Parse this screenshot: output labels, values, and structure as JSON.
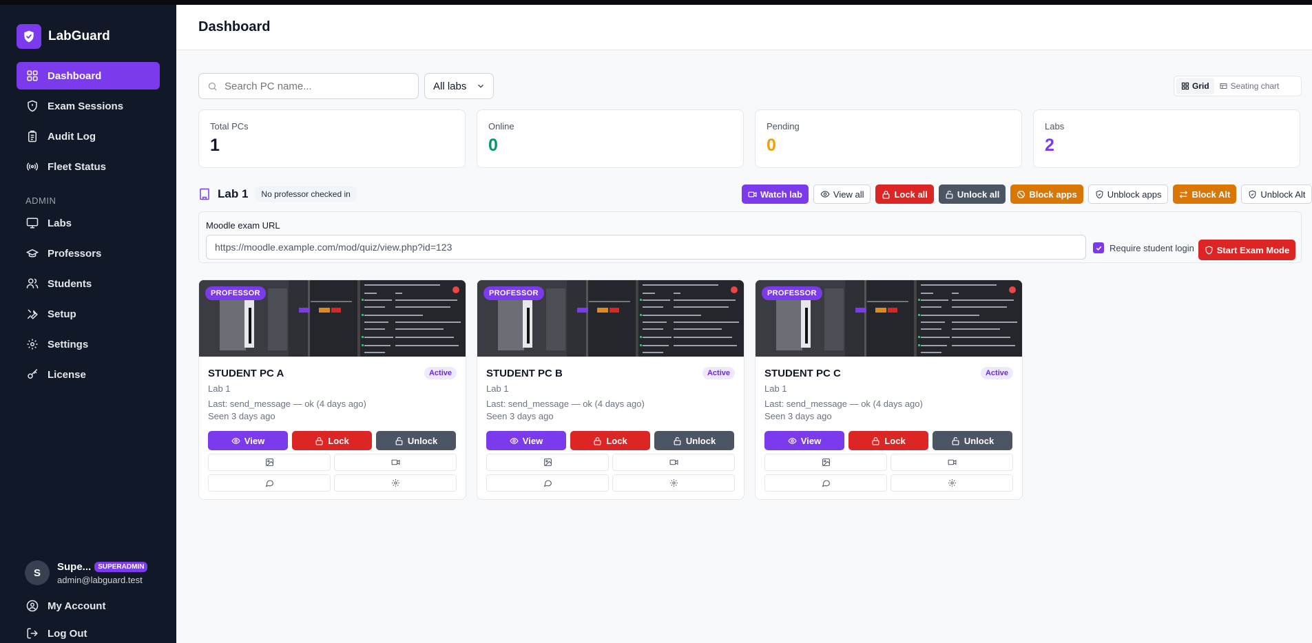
{
  "app": {
    "name": "LabGuard",
    "page_title": "Dashboard"
  },
  "sidebar": {
    "items": [
      {
        "label": "Dashboard",
        "icon": "grid-icon",
        "active": true
      },
      {
        "label": "Exam Sessions",
        "icon": "shield-icon"
      },
      {
        "label": "Audit Log",
        "icon": "clipboard-icon"
      },
      {
        "label": "Fleet Status",
        "icon": "broadcast-icon"
      }
    ],
    "section_label": "ADMIN",
    "admin_items": [
      {
        "label": "Labs",
        "icon": "monitor-icon"
      },
      {
        "label": "Professors",
        "icon": "graduation-cap-icon"
      },
      {
        "label": "Students",
        "icon": "users-icon"
      },
      {
        "label": "Setup",
        "icon": "tools-icon"
      },
      {
        "label": "Settings",
        "icon": "gear-icon"
      },
      {
        "label": "License",
        "icon": "key-icon"
      }
    ],
    "user": {
      "initial": "S",
      "name": "Supe...",
      "role": "SUPERADMIN",
      "email": "admin@labguard.test"
    },
    "footer": {
      "my_account": "My Account",
      "log_out": "Log Out"
    }
  },
  "toolbar": {
    "search_placeholder": "Search PC name...",
    "lab_filter": "All labs",
    "view_grid": "Grid",
    "view_seating": "Seating chart"
  },
  "stats": [
    {
      "label": "Total PCs",
      "value": "1",
      "color": "#111827"
    },
    {
      "label": "Online",
      "value": "0",
      "color": "#059669"
    },
    {
      "label": "Pending",
      "value": "0",
      "color": "#f59e0b"
    },
    {
      "label": "Labs",
      "value": "2",
      "color": "#7c3aed"
    }
  ],
  "lab": {
    "name": "Lab 1",
    "professor_status": "No professor checked in",
    "actions": {
      "watch": "Watch lab",
      "view_all": "View all",
      "lock_all": "Lock all",
      "unlock_all": "Unlock all",
      "block_apps": "Block apps",
      "unblock_apps": "Unblock apps",
      "block_alt": "Block Alt",
      "unblock_alt": "Unblock Alt"
    },
    "exam": {
      "label": "Moodle exam URL",
      "url": "https://moodle.example.com/mod/quiz/view.php?id=123",
      "require_login_label": "Require student login",
      "require_login_checked": true,
      "start_button": "Start Exam Mode"
    }
  },
  "pcs": [
    {
      "name": "STUDENT PC A",
      "badge": "PROFESSOR",
      "status": "Active",
      "lab": "Lab 1",
      "last": "Last: send_message — ok (4 days ago)",
      "seen": "Seen 3 days ago",
      "view": "View",
      "lock": "Lock",
      "unlock": "Unlock"
    },
    {
      "name": "STUDENT PC B",
      "badge": "PROFESSOR",
      "status": "Active",
      "lab": "Lab 1",
      "last": "Last: send_message — ok (4 days ago)",
      "seen": "Seen 3 days ago",
      "view": "View",
      "lock": "Lock",
      "unlock": "Unlock"
    },
    {
      "name": "STUDENT PC C",
      "badge": "PROFESSOR",
      "status": "Active",
      "lab": "Lab 1",
      "last": "Last: send_message — ok (4 days ago)",
      "seen": "Seen 3 days ago",
      "view": "View",
      "lock": "Lock",
      "unlock": "Unlock"
    }
  ]
}
